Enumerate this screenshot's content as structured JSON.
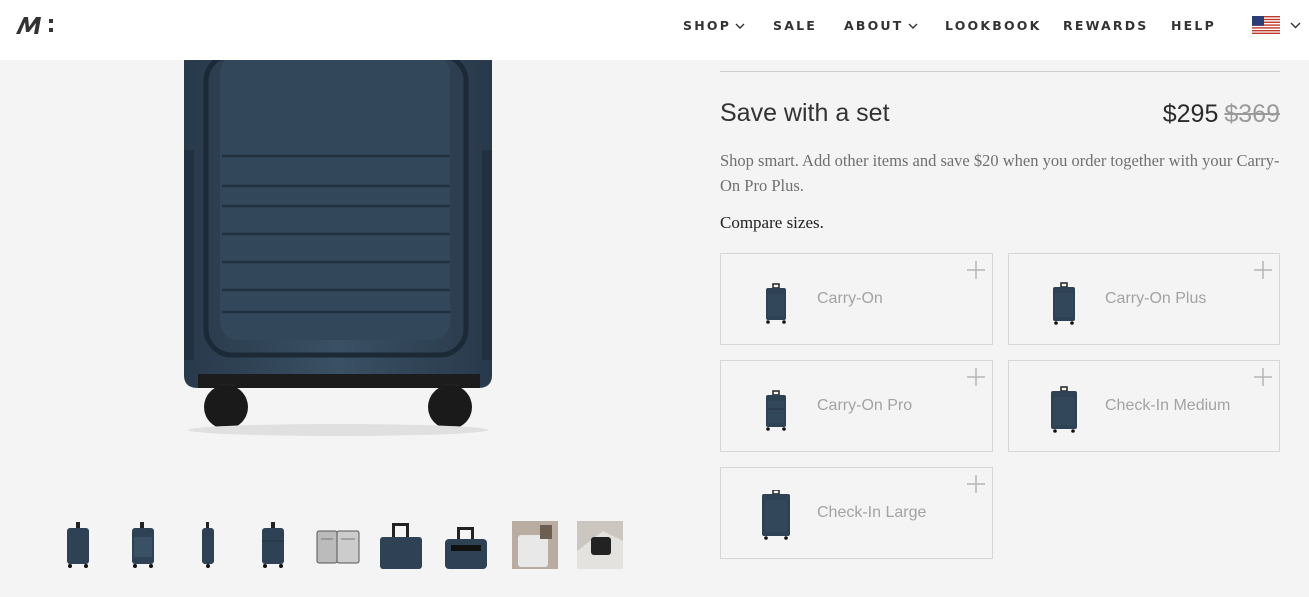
{
  "header": {
    "logo_alt": "M:",
    "nav": [
      {
        "label": "SHOP",
        "has_dropdown": true
      },
      {
        "label": "SALE",
        "has_dropdown": false
      },
      {
        "label": "ABOUT",
        "has_dropdown": true
      },
      {
        "label": "LOOKBOOK",
        "has_dropdown": false
      },
      {
        "label": "REWARDS",
        "has_dropdown": false
      },
      {
        "label": "HELP",
        "has_dropdown": false
      }
    ],
    "region_icon": "us-flag-icon"
  },
  "product": {
    "color": "#2f4255",
    "thumbnails": [
      "front",
      "angle",
      "side",
      "back",
      "open-interior",
      "handle-up",
      "top-handle",
      "in-use-white",
      "in-use-detail"
    ]
  },
  "set_offer": {
    "title": "Save with a set",
    "price": "$295",
    "original_price": "$369",
    "description": "Shop smart. Add other items and save $20 when you order together with your Carry-On Pro Plus.",
    "compare_label": "Compare sizes."
  },
  "sizes": [
    {
      "name": "Carry-On"
    },
    {
      "name": "Carry-On Plus"
    },
    {
      "name": "Carry-On Pro"
    },
    {
      "name": "Check-In Medium"
    },
    {
      "name": "Check-In Large"
    }
  ],
  "colors": {
    "accent": "#2f4255",
    "muted_text": "#a3a3a3",
    "border": "#d7d7d7"
  }
}
